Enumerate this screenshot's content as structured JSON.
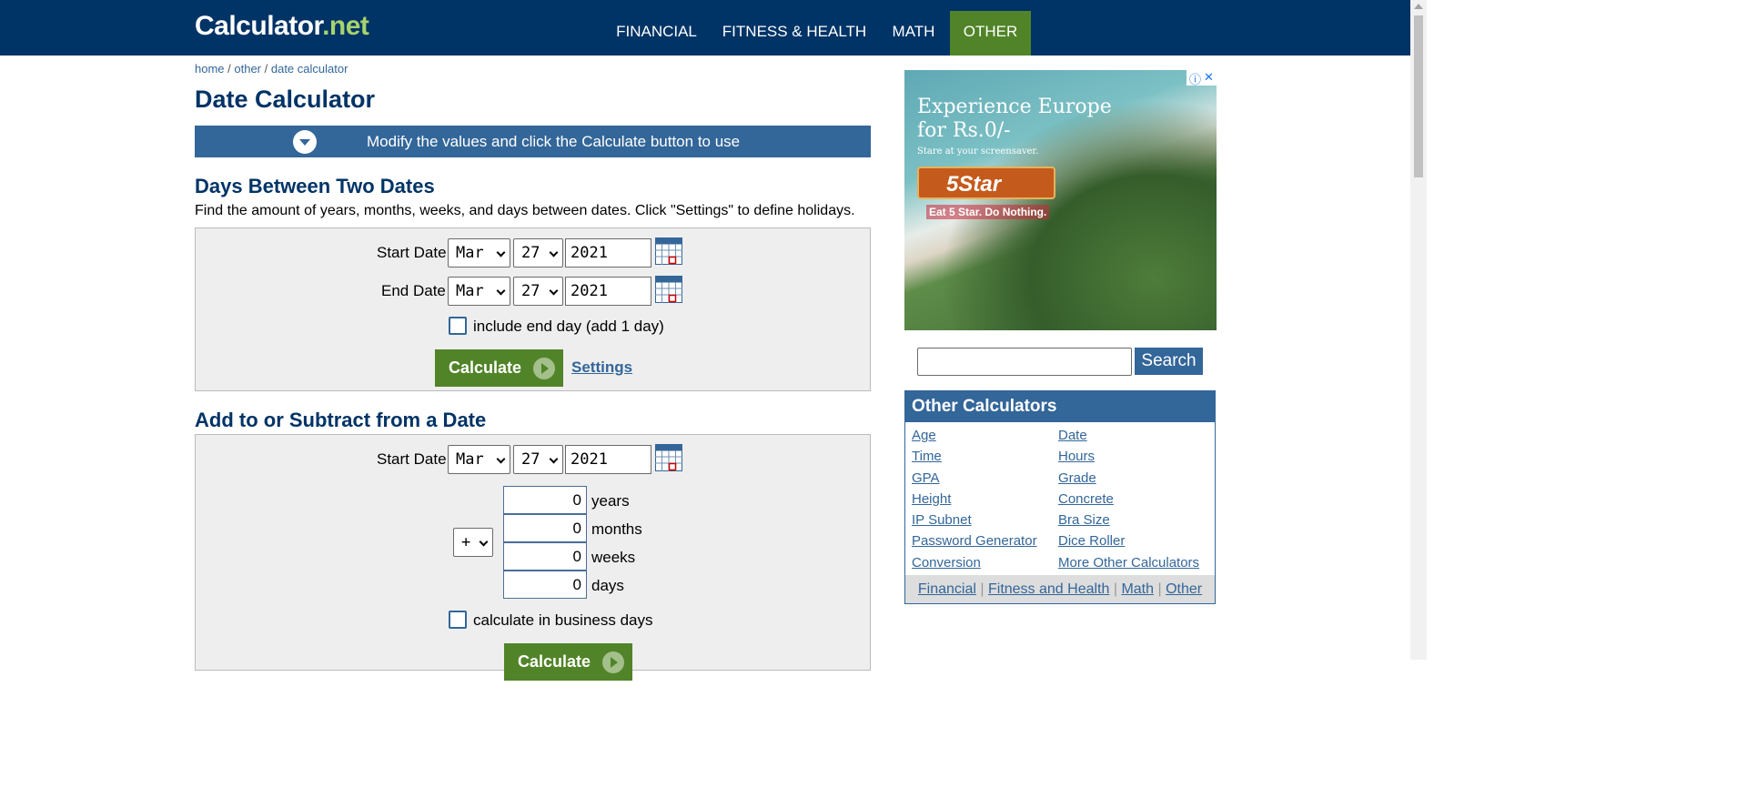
{
  "header": {
    "logo_main": "Calculator",
    "logo_tld": ".net",
    "nav": [
      "FINANCIAL",
      "FITNESS & HEALTH",
      "MATH",
      "OTHER"
    ],
    "active_nav": "OTHER"
  },
  "breadcrumb": {
    "home": "home",
    "sep": " / ",
    "other": "other",
    "current": "date calculator"
  },
  "page_title": "Date Calculator",
  "modify_bar": "Modify the values and click the Calculate button to use",
  "days_between": {
    "heading": "Days Between Two Dates",
    "description": "Find the amount of years, months, weeks, and days between dates. Click \"Settings\" to define holidays.",
    "start_label": "Start Date",
    "start_month": "Mar",
    "start_day": "27",
    "start_year": "2021",
    "end_label": "End Date",
    "end_month": "Mar",
    "end_day": "27",
    "end_year": "2021",
    "include_end_label": "include end day (add 1 day)",
    "calculate_label": "Calculate",
    "settings_label": "Settings"
  },
  "add_subtract": {
    "heading": "Add to or Subtract from a Date",
    "start_label": "Start Date",
    "start_month": "Mar",
    "start_day": "27",
    "start_year": "2021",
    "operator": "+",
    "years_value": "0",
    "years_label": "years",
    "months_value": "0",
    "months_label": "months",
    "weeks_value": "0",
    "weeks_label": "weeks",
    "days_value": "0",
    "days_label": "days",
    "business_label": "calculate in business days",
    "calculate_label": "Calculate"
  },
  "ad": {
    "headline_1": "Experience Europe",
    "headline_2": "for Rs.0/-",
    "sub": "Stare at your screensaver.",
    "brand": "5Star",
    "tagline": "Eat 5 Star. Do Nothing.",
    "info_icon": "ⓘ",
    "close_icon": "✕"
  },
  "search": {
    "value": "",
    "button_label": "Search"
  },
  "other_calculators": {
    "title": "Other Calculators",
    "left": [
      "Age",
      "Time",
      "GPA",
      "Height",
      "IP Subnet",
      "Password Generator",
      "Conversion"
    ],
    "right": [
      "Date",
      "Hours",
      "Grade",
      "Concrete",
      "Bra Size",
      "Dice Roller",
      "More Other Calculators"
    ],
    "footer": [
      "Financial",
      "Fitness and Health",
      "Math",
      "Other"
    ],
    "footer_sep": " | "
  },
  "colors": {
    "header_bg": "#003366",
    "accent": "#336699",
    "green": "#518428",
    "panel_bg": "#eeeeee"
  }
}
